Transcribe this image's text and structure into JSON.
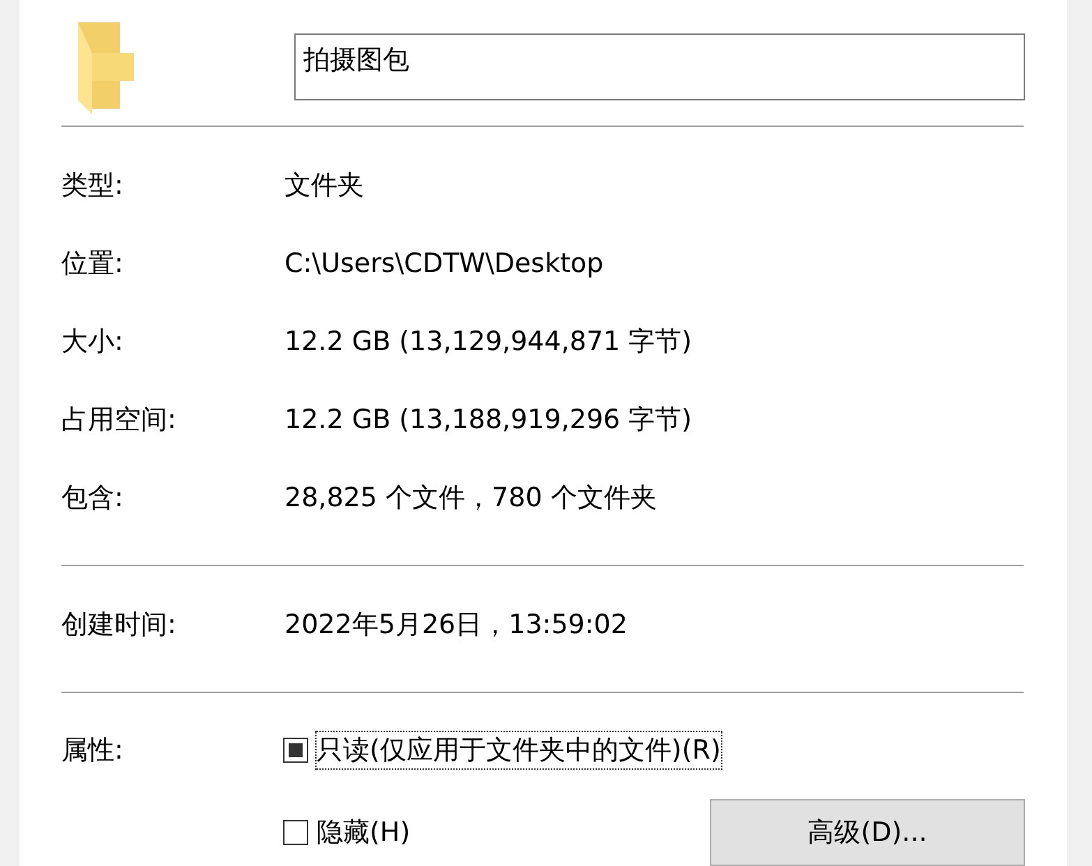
{
  "name_field": {
    "value": "拍摄图包"
  },
  "groups": [
    [
      {
        "label": "类型:",
        "value": "文件夹"
      },
      {
        "label": "位置:",
        "value": "C:\\Users\\CDTW\\Desktop"
      },
      {
        "label": "大小:",
        "value": "12.2 GB (13,129,944,871 字节)"
      },
      {
        "label": "占用空间:",
        "value": "12.2 GB (13,188,919,296 字节)"
      },
      {
        "label": "包含:",
        "value": "28,825 个文件，780 个文件夹"
      }
    ],
    [
      {
        "label": "创建时间:",
        "value": "2022年5月26日，13:59:02"
      }
    ]
  ],
  "attributes": {
    "label": "属性:",
    "checkboxes": [
      {
        "label": "只读(仅应用于文件夹中的文件)(R)",
        "checked": true,
        "indeterminate": true,
        "focused": true
      },
      {
        "label": "隐藏(H)",
        "checked": false,
        "indeterminate": false,
        "focused": false
      }
    ],
    "advanced_button": "高级(D)..."
  }
}
